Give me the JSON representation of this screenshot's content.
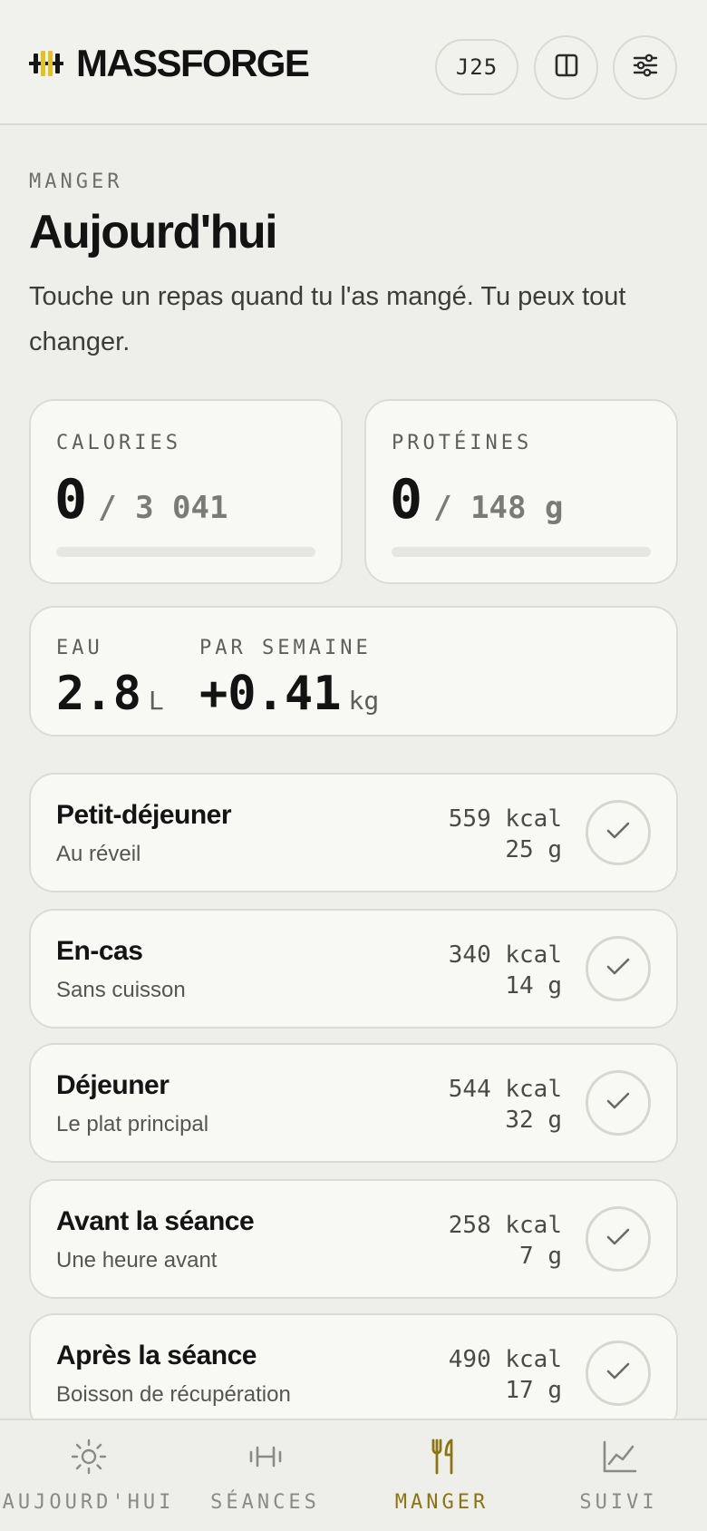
{
  "header": {
    "brand": "MASSFORGE",
    "day_badge": "J25",
    "split_icon": "split-view-icon",
    "settings_icon": "sliders-icon",
    "accent": "#e3c11f"
  },
  "intro": {
    "eyebrow": "MANGER",
    "title": "Aujourd'hui",
    "subtitle": "Touche un repas quand tu l'as mangé. Tu peux tout changer."
  },
  "stats": {
    "calories": {
      "label": "CALORIES",
      "value": "0",
      "goal": "/ 3 041",
      "progress": 0
    },
    "proteins": {
      "label": "PROTÉINES",
      "value": "0",
      "goal": "/ 148 g",
      "progress": 0
    }
  },
  "metrics": {
    "water": {
      "label": "EAU",
      "value": "2.8",
      "unit": "L"
    },
    "weekly": {
      "label": "PAR SEMAINE",
      "value": "+0.41",
      "unit": "kg"
    }
  },
  "meals": [
    {
      "name": "Petit-déjeuner",
      "sub": "Au réveil",
      "kcal": "559 kcal",
      "protein": "25 g"
    },
    {
      "name": "En-cas",
      "sub": "Sans cuisson",
      "kcal": "340 kcal",
      "protein": "14 g"
    },
    {
      "name": "Déjeuner",
      "sub": "Le plat principal",
      "kcal": "544 kcal",
      "protein": "32 g"
    },
    {
      "name": "Avant la séance",
      "sub": "Une heure avant",
      "kcal": "258 kcal",
      "protein": "7 g"
    },
    {
      "name": "Après la séance",
      "sub": "Boisson de récupération",
      "kcal": "490 kcal",
      "protein": "17 g"
    }
  ],
  "nav": [
    {
      "label": "AUJOURD'HUI",
      "icon": "sun-icon",
      "active": false
    },
    {
      "label": "SÉANCES",
      "icon": "dumbbell-icon",
      "active": false
    },
    {
      "label": "MANGER",
      "icon": "fork-knife-icon",
      "active": true
    },
    {
      "label": "SUIVI",
      "icon": "chart-icon",
      "active": false
    }
  ]
}
